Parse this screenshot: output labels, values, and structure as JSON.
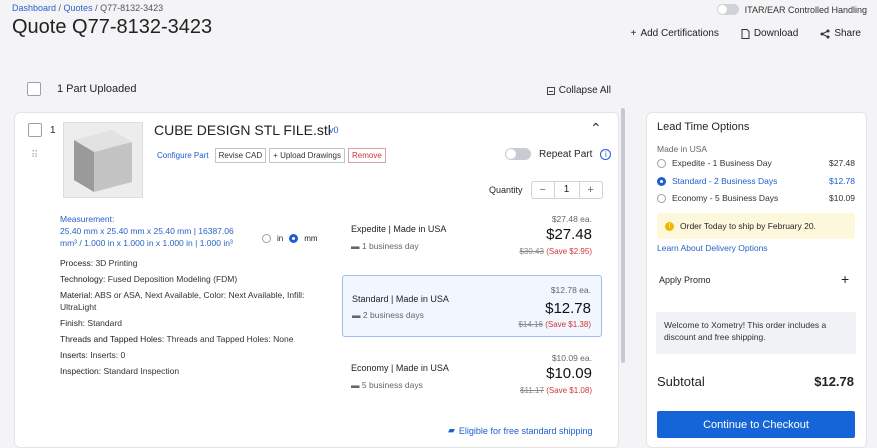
{
  "breadcrumb": {
    "dashboard": "Dashboard",
    "sep1": " / ",
    "quotes": "Quotes",
    "sep2": " / ",
    "current": "Q77-8132-3423"
  },
  "page_title": "Quote Q77-8132-3423",
  "itar_label": "ITAR/EAR Controlled Handling",
  "header_actions": {
    "certifications": "Add Certifications",
    "download": "Download",
    "share": "Share"
  },
  "parts_uploaded": "1 Part Uploaded",
  "collapse_all": "Collapse All",
  "part": {
    "index": "1",
    "name": "CUBE DESIGN STL FILE.stl",
    "version": "v0",
    "buttons": {
      "configure": "Configure Part",
      "revise": "Revise CAD",
      "upload": "+ Upload Drawings",
      "remove": "Remove"
    },
    "repeat_label": "Repeat Part",
    "quantity_label": "Quantity",
    "quantity": "1",
    "measurement_label": "Measurement:",
    "measurement_text": "25.40 mm x 25.40 mm x 25.40 mm | 16387.06 mm³ / 1.000 in x 1.000 in x 1.000 in | 1.000 in³",
    "unit_in": "in",
    "unit_mm": "mm",
    "specs": [
      {
        "label": "Process:",
        "value": "3D Printing"
      },
      {
        "label": "Technology:",
        "value": "Fused Deposition Modeling (FDM)"
      },
      {
        "label": "Material:",
        "value": "ABS or ASA, Next Available, Color: Next Available, Infill: UltraLight"
      },
      {
        "label": "Finish:",
        "value": "Standard"
      },
      {
        "label": "Threads and Tapped Holes:",
        "value": "Threads and Tapped Holes: None"
      },
      {
        "label": "Inserts:",
        "value": "Inserts: 0"
      },
      {
        "label": "Inspection:",
        "value": "Standard Inspection"
      }
    ],
    "options": [
      {
        "name": "Expedite",
        "made": "Made in USA",
        "days": "1 business day",
        "each": "$27.48 ea.",
        "price": "$27.48",
        "old": "$30.43",
        "save": "(Save $2.95)"
      },
      {
        "name": "Standard",
        "made": "Made in USA",
        "days": "2 business days",
        "each": "$12.78 ea.",
        "price": "$12.78",
        "old": "$14.16",
        "save": "(Save $1.38)"
      },
      {
        "name": "Economy",
        "made": "Made in USA",
        "days": "5 business days",
        "each": "$10.09 ea.",
        "price": "$10.09",
        "old": "$11.17",
        "save": "(Save $1.08)"
      }
    ],
    "shipping_note": "Eligible for free standard shipping"
  },
  "sidebar": {
    "title": "Lead Time Options",
    "made": "Made in USA",
    "options": [
      {
        "label": "Expedite - 1 Business Day",
        "price": "$27.48"
      },
      {
        "label": "Standard - 2 Business Days",
        "price": "$12.78"
      },
      {
        "label": "Economy - 5 Business Days",
        "price": "$10.09"
      }
    ],
    "notice": "Order Today to ship by February 20.",
    "learn_more": "Learn About Delivery Options",
    "promo": "Apply Promo",
    "welcome": "Welcome to Xometry! This order includes a discount and free shipping.",
    "subtotal_label": "Subtotal",
    "subtotal_value": "$12.78",
    "checkout": "Continue to Checkout"
  },
  "colors": {
    "accent": "#1565d8",
    "danger": "#d0363b",
    "notice": "#fdf8dc"
  }
}
